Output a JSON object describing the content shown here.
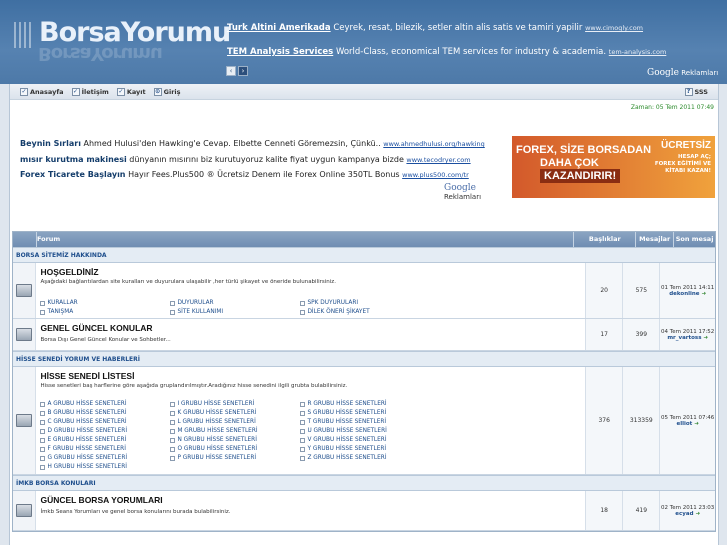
{
  "header": {
    "logo_text": "BorsaYorumu",
    "ads": [
      {
        "title": "Turk Altini Amerikada",
        "text": "Ceyrek, resat, bilezik, setler altin alis satis ve tamiri yapilir",
        "url": "www.cimogly.com"
      },
      {
        "title": "TEM Analysis Services",
        "text": "World-Class, economical TEM services for industry & academia.",
        "url": "tem-analysis.com"
      }
    ],
    "prev_icon": "chevron-left-icon",
    "next_icon": "chevron-right-icon",
    "google_brand": "Google",
    "google_label": "Reklamları"
  },
  "nav": {
    "items": [
      {
        "label": "Anasayfa",
        "icon": "home-icon"
      },
      {
        "label": "İletişim",
        "icon": "contact-icon"
      },
      {
        "label": "Kayıt",
        "icon": "register-icon"
      },
      {
        "label": "Giriş",
        "icon": "login-icon"
      }
    ],
    "faq": "SSS",
    "time": "Zaman: 05 Tem 2011 07:49"
  },
  "ads2": [
    {
      "title": "Beynin Sırları",
      "text": "Ahmed Hulusi'den Hawking'e Cevap. Elbette Cenneti Göremezsin, Çünkü..",
      "url": "www.ahmedhulusi.org/hawking"
    },
    {
      "title": "mısır kurutma makinesi",
      "text": "dünyanın mısırını biz kurutuyoruz kalite fiyat uygun kampanya bizde",
      "url": "www.tecodryer.com"
    },
    {
      "title": "Forex Ticarete Başlayın",
      "text": "Hayır Fees.Plus500 ® Ücretsiz Denem ile Forex Online 350TL Bonus",
      "url": "www.plus500.com/tr"
    }
  ],
  "ads2_google": "Google",
  "ads2_label": "Reklamları",
  "banner": {
    "line1": "FOREX, SİZE BORSADAN",
    "line2": "DAHA ÇOK",
    "line3": "KAZANDIRIR!",
    "badge": "ÜCRETSİZ",
    "badge_sub": "HESAP AÇ;\nFOREX EĞİTİMİ VE\nKİTABI KAZAN!"
  },
  "table": {
    "headers": {
      "forum": "Forum",
      "topics": "Başlıklar",
      "posts": "Mesajlar",
      "last": "Son mesaj"
    },
    "categories": [
      {
        "name": "BORSA SİTEMİZ HAKKINDA",
        "forums": [
          {
            "title": "HOŞGELDİNİZ",
            "desc": "Aşağıdaki bağlantılardan site kuralları ve duyurulara ulaşabilir ,her türlü şikayet ve öneride bulunabilirsiniz.",
            "subs": [
              "KURALLAR",
              "DUYURULAR",
              "SPK DUYURULARI",
              "TANIŞMA",
              "SİTE KULLANIMI",
              "DİLEK ÖNERİ ŞİKAYET"
            ],
            "topics": "20",
            "posts": "575",
            "last_date": "01 Tem 2011 14:11",
            "last_user": "dekonline"
          },
          {
            "title": "GENEL GÜNCEL KONULAR",
            "desc": "Borsa Dışı Genel Güncel Konular ve Sohbetler...",
            "subs": [],
            "topics": "17",
            "posts": "399",
            "last_date": "04 Tem 2011 17:52",
            "last_user": "mr_vartoss"
          }
        ]
      },
      {
        "name": "HİSSE SENEDİ YORUM VE HABERLERİ",
        "forums": [
          {
            "title": "HİSSE SENEDİ LİSTESİ",
            "desc": "Hisse senetleri baş harflerine göre aşağıda gruplandırılmıştır.Aradığınız hisse senedini ilgili grubta bulabilirsiniz.",
            "subs": [
              "A GRUBU HİSSE SENETLERİ",
              "I GRUBU HİSSE SENETLERİ",
              "R GRUBU HİSSE SENETLERİ",
              "B GRUBU HİSSE SENETLERİ",
              "K GRUBU HİSSE SENETLERİ",
              "S GRUBU HİSSE SENETLERİ",
              "C GRUBU HİSSE SENETLERİ",
              "L GRUBU HİSSE SENETLERİ",
              "T GRUBU HİSSE SENETLERİ",
              "D GRUBU HİSSE SENETLERİ",
              "M GRUBU HİSSE SENETLERİ",
              "U GRUBU HİSSE SENETLERİ",
              "E GRUBU HİSSE SENETLERİ",
              "N GRUBU HİSSE SENETLERİ",
              "V GRUBU HİSSE SENETLERİ",
              "F GRUBU HİSSE SENETLERİ",
              "O GRUBU HİSSE SENETLERİ",
              "Y GRUBU HİSSE SENETLERİ",
              "G GRUBU HİSSE SENETLERİ",
              "P GRUBU HİSSE SENETLERİ",
              "Z GRUBU HİSSE SENETLERİ",
              "H GRUBU HİSSE SENETLERİ"
            ],
            "topics": "376",
            "posts": "313359",
            "last_date": "05 Tem 2011 07:46",
            "last_user": "elliot"
          }
        ]
      },
      {
        "name": "İMKB BORSA KONULARI",
        "forums": [
          {
            "title": "GÜNCEL BORSA YORUMLARI",
            "desc": "İmkb Seans Yorumları ve genel borsa konularını burada bulabilirsiniz.",
            "subs": [],
            "topics": "18",
            "posts": "419",
            "last_date": "02 Tem 2011 23:03",
            "last_user": "ecyad"
          }
        ]
      }
    ]
  }
}
